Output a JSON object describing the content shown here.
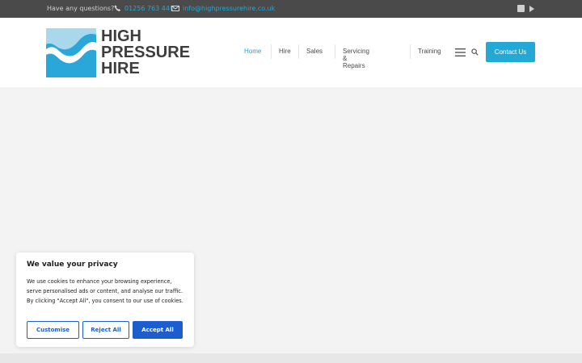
{
  "topbar": {
    "question": "Have any questions?",
    "phone": "01256 763 440",
    "email": "info@highpressurehire.co.uk",
    "icons": [
      "phone-icon",
      "mail-icon",
      "facebook-icon",
      "youtube-icon"
    ]
  },
  "logo": {
    "lines": [
      "HIGH",
      "PRESSURE",
      "HIRE"
    ],
    "colors": {
      "light": "#a9d8ec",
      "mid": "#2aa7d9",
      "dark": "#3d3d3d"
    }
  },
  "nav": {
    "items": [
      "Home",
      "Hire",
      "Sales",
      "Servicing & Repairs",
      "Training"
    ],
    "active": "Home",
    "icons": [
      "menu-icon",
      "search-icon"
    ],
    "contact_label": "Contact Us"
  },
  "cookie": {
    "title": "We value your privacy",
    "text": "We use cookies to enhance your browsing experience, serve personalised ads or content, and analyse our traffic. By clicking \"Accept All\", you consent to our use of cookies.",
    "customise": "Customise",
    "reject": "Reject All",
    "accept": "Accept All"
  },
  "colors": {
    "accent": "#24a8d6",
    "topbar": "#4a4a4a",
    "cookie_button": "#1d5ecf"
  }
}
